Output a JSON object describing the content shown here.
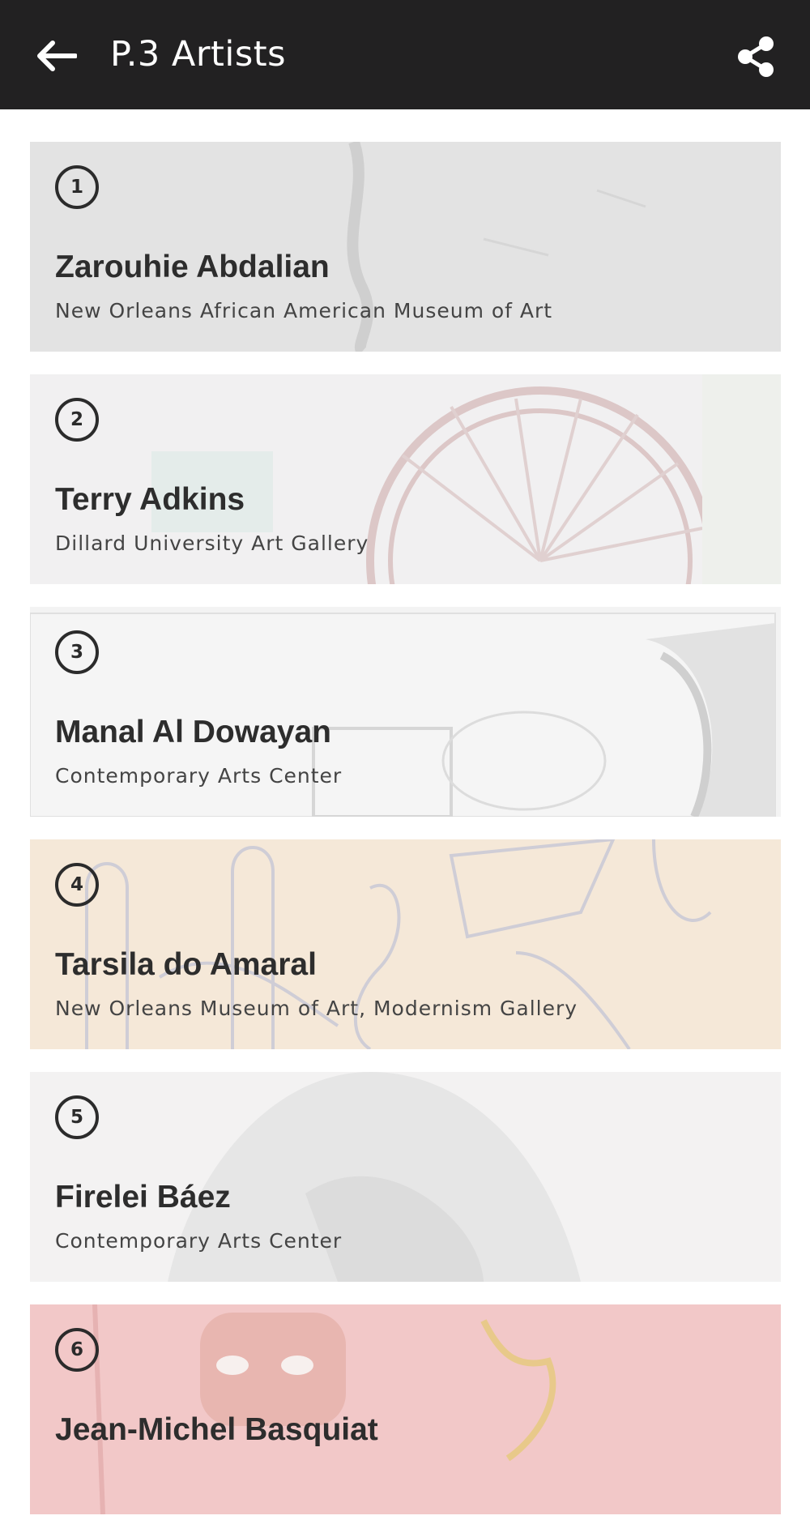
{
  "header": {
    "title": "P.3 Artists",
    "back_icon": "arrow-left-icon",
    "share_icon": "share-icon"
  },
  "artists": [
    {
      "number": "1",
      "name": "Zarouhie Abdalian",
      "venue": "New Orleans African American Museum of Art",
      "tint": "#e4e4e4"
    },
    {
      "number": "2",
      "name": "Terry Adkins",
      "venue": "Dillard University Art Gallery",
      "tint": "#f1f0f1"
    },
    {
      "number": "3",
      "name": "Manal Al Dowayan",
      "venue": "Contemporary Arts Center",
      "tint": "#f2f2f2"
    },
    {
      "number": "4",
      "name": "Tarsila do Amaral",
      "venue": "New Orleans Museum of Art, Modernism Gallery",
      "tint": "#f5e8d8"
    },
    {
      "number": "5",
      "name": "Firelei Báez",
      "venue": "Contemporary Arts Center",
      "tint": "#f3f2f2"
    },
    {
      "number": "6",
      "name": "Jean-Michel Basquiat",
      "venue": "",
      "tint": "#f2c8c8"
    }
  ]
}
